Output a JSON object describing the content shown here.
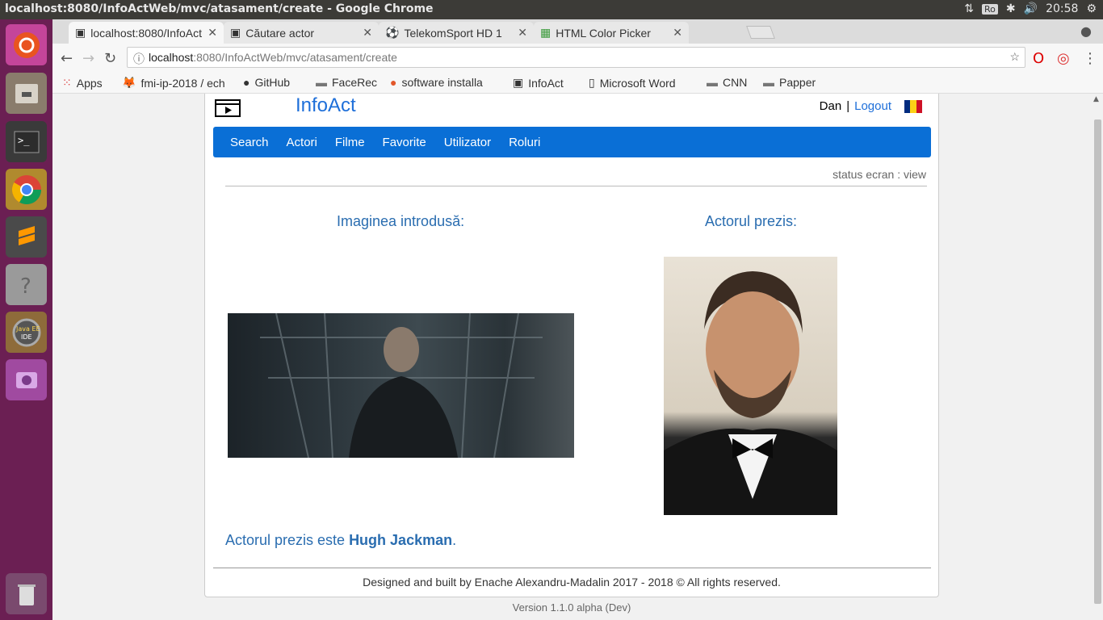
{
  "window": {
    "title": "localhost:8080/InfoActWeb/mvc/atasament/create - Google Chrome",
    "keyboard": "Ro",
    "clock": "20:58"
  },
  "tabs": [
    {
      "label": "localhost:8080/InfoAct",
      "active": true
    },
    {
      "label": "Căutare actor"
    },
    {
      "label": "TelekomSport HD 1"
    },
    {
      "label": "HTML Color Picker"
    }
  ],
  "omnibox": {
    "host": "localhost",
    "path": ":8080/InfoActWeb/mvc/atasament/create"
  },
  "bookmarks": [
    "Apps",
    "fmi-ip-2018 / ech",
    "GitHub",
    "FaceRec",
    "software installa",
    "InfoAct",
    "Microsoft Word",
    "CNN",
    "Papper"
  ],
  "site": {
    "brand": "InfoAct",
    "user": "Dan",
    "separator": "|",
    "logout": "Logout",
    "nav": [
      "Search",
      "Actori",
      "Filme",
      "Favorite",
      "Utilizator",
      "Roluri"
    ],
    "status": "status ecran : view",
    "left_heading": "Imaginea introdusă:",
    "right_heading": "Actorul prezis:",
    "result_prefix": "Actorul prezis este ",
    "result_name": "Hugh Jackman",
    "result_suffix": ".",
    "footer": "Designed and built by Enache Alexandru-Madalin 2017 - 2018 © All rights reserved.",
    "version": "Version 1.1.0 alpha (Dev)"
  },
  "colors": {
    "accent": "#0a6fd6",
    "link": "#1e6fd9",
    "heading": "#2a6db0",
    "launcher": "#6b1f53"
  }
}
